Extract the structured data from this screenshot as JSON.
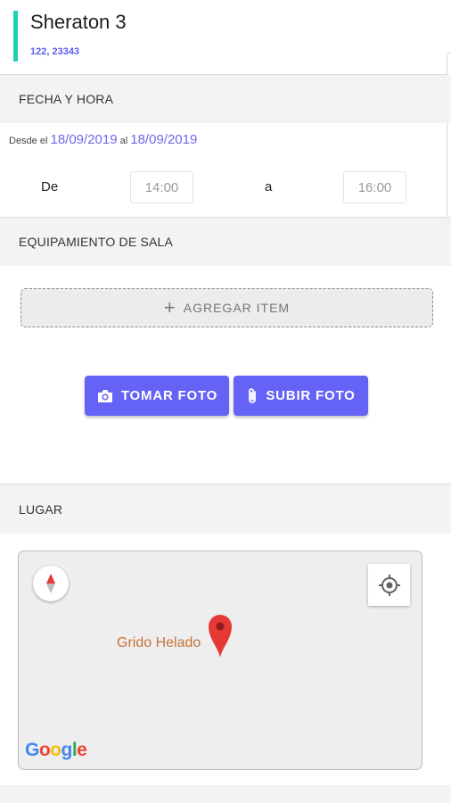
{
  "header": {
    "title": "Sheraton 3",
    "subtitle": "122, 23343",
    "accent_color": "#1fcfb4",
    "subtitle_color": "#5e5ce6"
  },
  "date_section": {
    "heading": "FECHA Y HORA",
    "from_prefix": "Desde el",
    "from_date": "18/09/2019",
    "to_prefix": "al",
    "to_date": "18/09/2019",
    "date_color": "#6e6ae6",
    "from_time_label": "De",
    "from_time": "14:00",
    "to_time_label": "a",
    "to_time": "16:00"
  },
  "equipment_section": {
    "heading": "EQUIPAMIENTO DE SALA",
    "add_item_label": "AGREGAR ITEM",
    "take_photo_label": "TOMAR FOTO",
    "upload_photo_label": "SUBIR FOTO",
    "button_color": "#6563f5"
  },
  "place_section": {
    "heading": "LUGAR",
    "place_name": "Grido Helado",
    "map_brand": "Google",
    "pin_color": "#e53935"
  }
}
